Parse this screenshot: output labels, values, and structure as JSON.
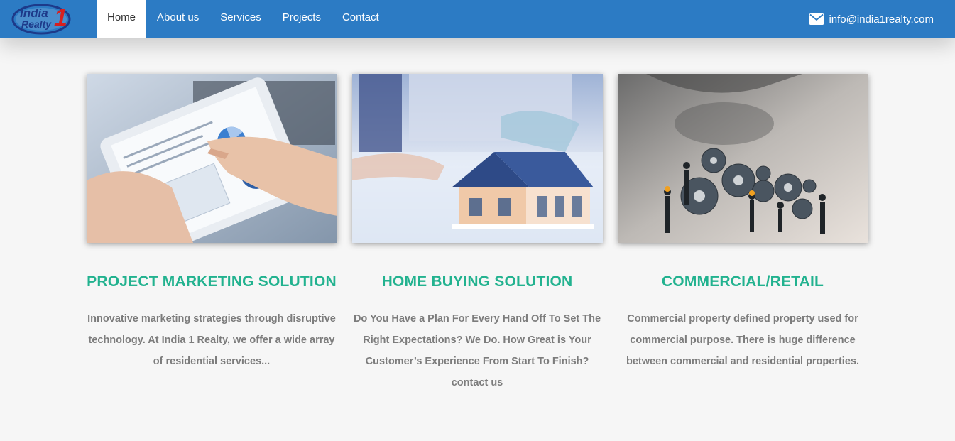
{
  "header": {
    "logo_text_line1": "India",
    "logo_text_line2": "Realty",
    "logo_numeral": "1",
    "nav": [
      {
        "label": "Home",
        "active": true
      },
      {
        "label": "About us"
      },
      {
        "label": "Services"
      },
      {
        "label": "Projects"
      },
      {
        "label": "Contact"
      }
    ],
    "email_icon": "mail-icon",
    "email": "info@india1realty.com"
  },
  "cards": [
    {
      "title": "PROJECT MARKETING SOLUTION",
      "text": "Innovative marketing strategies through disruptive technology. At India 1 Realty, we offer a wide array of residential services...",
      "image": "tablet-chart-image"
    },
    {
      "title": "HOME BUYING SOLUTION",
      "text": "Do You Have a Plan For Every Hand Off To Set The Right Expectations? We Do. How Great is Your Customer’s Experience From Start To Finish? contact us",
      "image": "house-model-image"
    },
    {
      "title": "COMMERCIAL/RETAIL",
      "text": "Commercial property defined property used for commercial purpose. There is huge difference between commercial and residential properties.",
      "image": "gears-teamwork-image"
    }
  ],
  "colors": {
    "nav_bg": "#2c7bc4",
    "accent": "#22b28f",
    "body_text": "#7c7c7c",
    "page_bg": "#f6f6f6"
  }
}
